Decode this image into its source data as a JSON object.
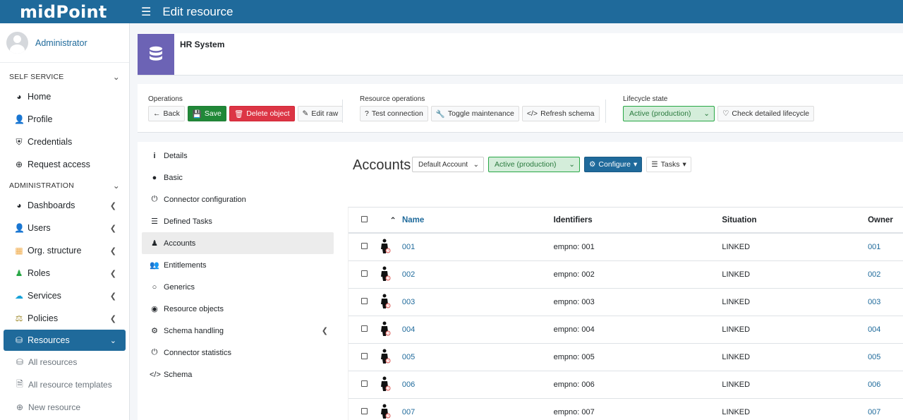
{
  "header": {
    "brand": "midPoint",
    "page_title": "Edit resource"
  },
  "sidebar": {
    "user": "Administrator",
    "sections": {
      "self_service": "SELF SERVICE",
      "administration": "ADMINISTRATION"
    },
    "self_items": [
      {
        "label": "Home",
        "icon": "gauge-icon"
      },
      {
        "label": "Profile",
        "icon": "user-icon"
      },
      {
        "label": "Credentials",
        "icon": "shield-icon"
      },
      {
        "label": "Request access",
        "icon": "plus-circle-icon"
      }
    ],
    "admin_items": [
      {
        "label": "Dashboards",
        "icon": "gauge-icon"
      },
      {
        "label": "Users",
        "icon": "user-icon"
      },
      {
        "label": "Org. structure",
        "icon": "building-icon"
      },
      {
        "label": "Roles",
        "icon": "role-icon"
      },
      {
        "label": "Services",
        "icon": "cloud-icon"
      },
      {
        "label": "Policies",
        "icon": "scale-icon"
      },
      {
        "label": "Resources",
        "icon": "database-icon"
      }
    ],
    "resource_sub": [
      {
        "label": "All resources",
        "icon": "database-icon"
      },
      {
        "label": "All resource templates",
        "icon": "file-icon"
      },
      {
        "label": "New resource",
        "icon": "plus-circle-icon"
      }
    ]
  },
  "object": {
    "name": "HR System"
  },
  "operations": {
    "label": "Operations",
    "back": "Back",
    "save": "Save",
    "delete": "Delete object",
    "edit_raw": "Edit raw"
  },
  "resource_operations": {
    "label": "Resource operations",
    "test": "Test connection",
    "toggle": "Toggle maintenance",
    "refresh": "Refresh schema"
  },
  "lifecycle": {
    "label": "Lifecycle state",
    "value": "Active (production)",
    "check": "Check detailed lifecycle"
  },
  "left_menu": [
    {
      "label": "Details",
      "icon": "info-icon"
    },
    {
      "label": "Basic",
      "icon": "circle-icon"
    },
    {
      "label": "Connector configuration",
      "icon": "plug-icon"
    },
    {
      "label": "Defined Tasks",
      "icon": "tasks-icon"
    },
    {
      "label": "Accounts",
      "icon": "person-icon"
    },
    {
      "label": "Entitlements",
      "icon": "users-icon"
    },
    {
      "label": "Generics",
      "icon": "ring-icon"
    },
    {
      "label": "Resource objects",
      "icon": "eye-icon"
    },
    {
      "label": "Schema handling",
      "icon": "cogs-icon"
    },
    {
      "label": "Connector statistics",
      "icon": "plug-icon"
    },
    {
      "label": "Schema",
      "icon": "code-icon"
    }
  ],
  "accounts": {
    "title": "Accounts",
    "intent": "Default Account",
    "lifecycle": "Active (production)",
    "configure": "Configure",
    "tasks": "Tasks",
    "columns": {
      "name": "Name",
      "identifiers": "Identifiers",
      "situation": "Situation",
      "owner": "Owner"
    },
    "rows": [
      {
        "name": "001",
        "identifier": "empno: 001",
        "situation": "LINKED",
        "owner": "001"
      },
      {
        "name": "002",
        "identifier": "empno: 002",
        "situation": "LINKED",
        "owner": "002"
      },
      {
        "name": "003",
        "identifier": "empno: 003",
        "situation": "LINKED",
        "owner": "003"
      },
      {
        "name": "004",
        "identifier": "empno: 004",
        "situation": "LINKED",
        "owner": "004"
      },
      {
        "name": "005",
        "identifier": "empno: 005",
        "situation": "LINKED",
        "owner": "005"
      },
      {
        "name": "006",
        "identifier": "empno: 006",
        "situation": "LINKED",
        "owner": "006"
      },
      {
        "name": "007",
        "identifier": "empno: 007",
        "situation": "LINKED",
        "owner": "007"
      }
    ]
  },
  "colors": {
    "primary": "#1f6a9b",
    "success": "#218838",
    "danger": "#dc3545",
    "object_icon_bg": "#6c63b5"
  }
}
